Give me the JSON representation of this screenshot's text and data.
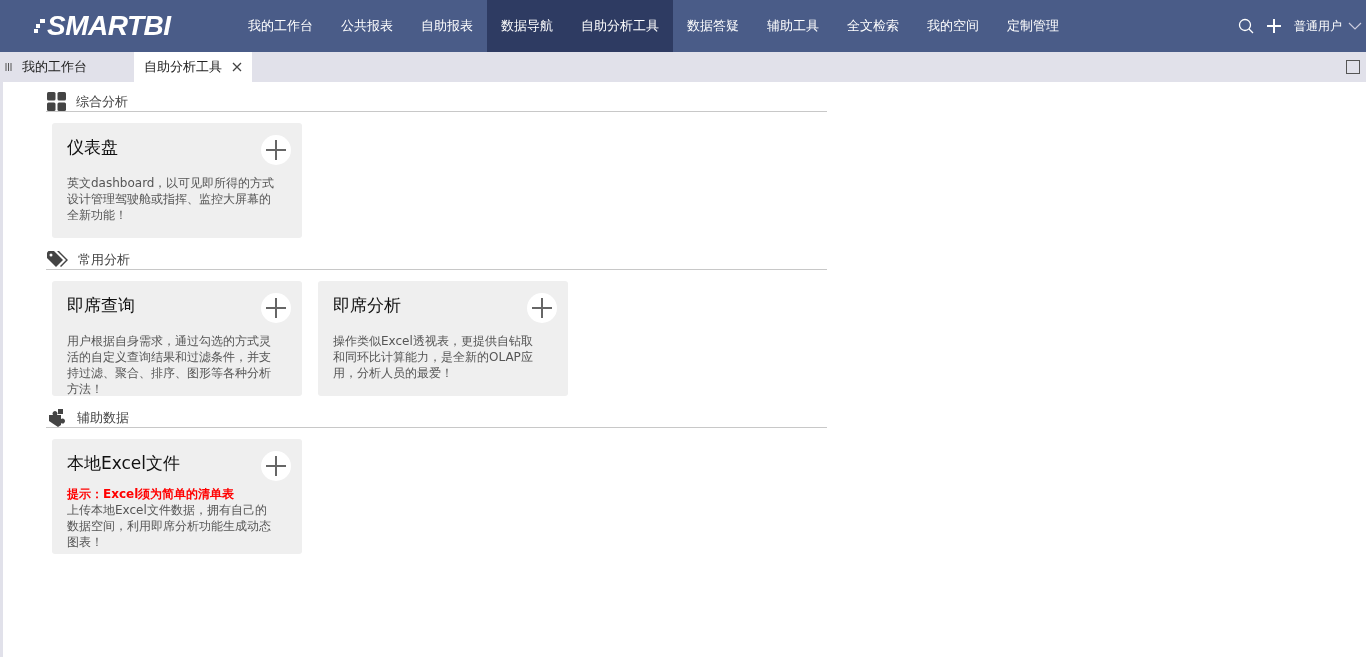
{
  "header": {
    "logo": "SMARTBI",
    "nav": [
      {
        "label": "我的工作台",
        "selected": false
      },
      {
        "label": "公共报表",
        "selected": false
      },
      {
        "label": "自助报表",
        "selected": false
      },
      {
        "label": "数据导航",
        "selected": true
      },
      {
        "label": "自助分析工具",
        "selected": true
      },
      {
        "label": "数据答疑",
        "selected": false
      },
      {
        "label": "辅助工具",
        "selected": false
      },
      {
        "label": "全文检索",
        "selected": false
      },
      {
        "label": "我的空间",
        "selected": false
      },
      {
        "label": "定制管理",
        "selected": false
      }
    ],
    "user": "普通用户"
  },
  "tabs": [
    {
      "label": "我的工作台",
      "selected": false,
      "closable": false
    },
    {
      "label": "自助分析工具",
      "selected": true,
      "closable": true
    }
  ],
  "sections": [
    {
      "title": "综合分析",
      "kind": "grid",
      "cards": [
        {
          "title": "仪表盘",
          "description": "英文dashboard，以可见即所得的方式设计管理驾驶舱或指挥、监控大屏幕的全新功能！"
        }
      ]
    },
    {
      "title": "常用分析",
      "kind": "tag",
      "cards": [
        {
          "title": "即席查询",
          "description": "用户根据自身需求，通过勾选的方式灵活的自定义查询结果和过滤条件，并支持过滤、聚合、排序、图形等各种分析方法！"
        },
        {
          "title": "即席分析",
          "description": "操作类似Excel透视表，更提供自钻取和同环比计算能力，是全新的OLAP应用，分析人员的最爱！"
        }
      ]
    },
    {
      "title": "辅助数据",
      "kind": "puzzle",
      "cards": [
        {
          "title": "本地Excel文件",
          "hint": "提示：Excel须为简单的清单表",
          "description": "上传本地Excel文件数据，拥有自己的数据空间，利用即席分析功能生成动态图表！"
        }
      ]
    }
  ]
}
